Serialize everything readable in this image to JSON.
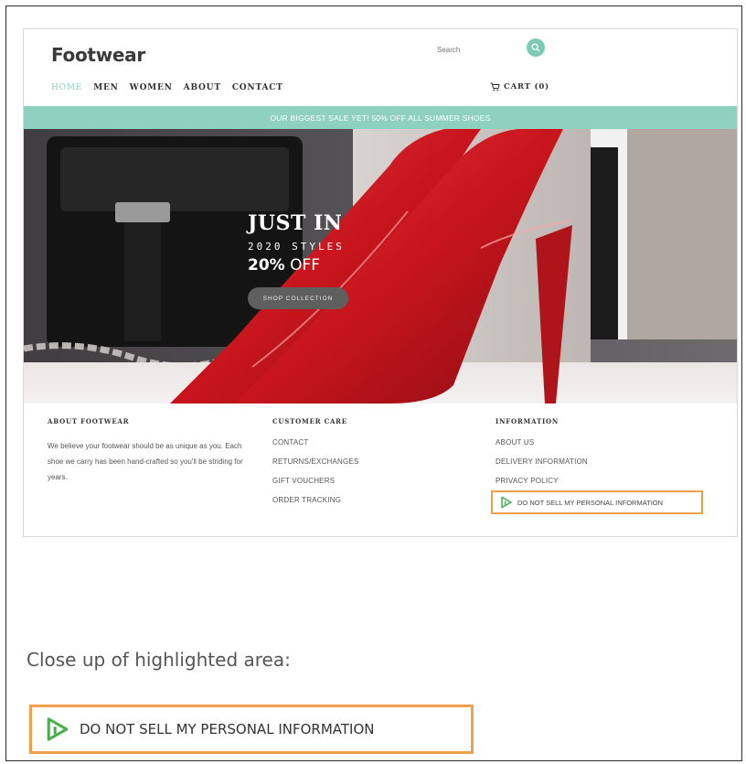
{
  "site": {
    "logo": "Footwear",
    "search_placeholder": "Search",
    "nav": [
      "HOME",
      "MEN",
      "WOMEN",
      "ABOUT",
      "CONTACT"
    ],
    "cart_label": "CART (0)",
    "promo_text": "OUR BIGGEST SALE YET! 50% OFF ALL SUMMER SHOES",
    "hero": {
      "title": "JUST IN",
      "subtitle": "2020 STYLES",
      "offer_percent": "20%",
      "offer_word": "OFF",
      "button_label": "SHOP COLLECTION"
    },
    "footer": {
      "about_heading": "ABOUT FOOTWEAR",
      "about_text": "We believe your footwear should be as unique as you. Each shoe we carry has been hand-crafted so you'll be striding for years.",
      "care_heading": "CUSTOMER CARE",
      "care_links": [
        "CONTACT",
        "RETURNS/EXCHANGES",
        "GIFT VOUCHERS",
        "ORDER TRACKING"
      ],
      "info_heading": "INFORMATION",
      "info_links": [
        "ABOUT US",
        "DELIVERY INFORMATION",
        "PRIVACY POLICY"
      ],
      "dns_link": "DO NOT SELL MY PERSONAL INFORMATION"
    }
  },
  "caption": "Close up of highlighted area:",
  "closeup_link": "DO NOT SELL MY PERSONAL INFORMATION",
  "colors": {
    "accent": "#8fd1bf",
    "highlight": "#f0a04b",
    "heel_red": "#c8151d",
    "dns_icon_green": "#4cae4f"
  },
  "icons": [
    "search-icon",
    "cart-icon",
    "privacy-options-icon"
  ]
}
